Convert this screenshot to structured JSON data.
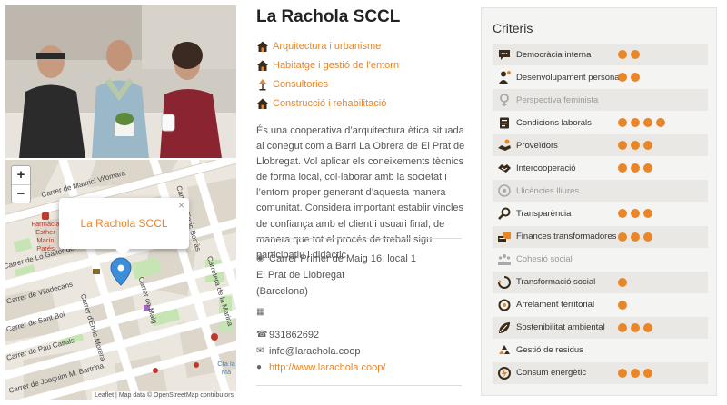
{
  "entity": {
    "name": "La Rachola SCCL",
    "activities": [
      {
        "label": "Arquitectura i urbanisme",
        "icon": "house-icon"
      },
      {
        "label": "Habitatge i gestió de l'entorn",
        "icon": "house-icon"
      },
      {
        "label": "Consultories",
        "icon": "lamp-icon"
      },
      {
        "label": "Construcció i rehabilitació",
        "icon": "house-icon"
      }
    ],
    "description": "És una cooperativa d’arquitectura ètica situada al conegut com a Barri La Obrera de El Prat de Llobregat. Vol aplicar els coneixements tècnics de forma local, col·laborar amb la societat i l’entorn proper generant d’aquesta manera comunitat. Considera important establir vincles de confiança amb el client i usuari final, de manera que tot el procés de treball sigui participatiu i didàctic.",
    "address": {
      "street": "Carrer Primer de Maig 16, local 1",
      "city": "El Prat de Llobregat",
      "region": "(Barcelona)"
    },
    "phone": "931862692",
    "email": "info@larachola.coop",
    "web": "http://www.larachola.coop/"
  },
  "map": {
    "popup_label": "La Rachola SCCL",
    "close_label": "×",
    "zoom_in": "+",
    "zoom_out": "−",
    "attribution": "Leaflet | Map data © OpenStreetMap contributors",
    "streets": [
      "Carrer de Maurici Vilomara",
      "Carrer de Lo Gaiter del Llobregat",
      "Carrer de Viladecans",
      "Carrer de Sant Boi",
      "Carrer de Pau Casals",
      "Carrer de Joaquim M. Bartrina",
      "Carrer d'Enric Morera",
      "Carrer d'Enric Borràs",
      "Carretera de la Marina",
      "Carrer de Maig"
    ],
    "poi": "Farmàcia Esther Marín Parés",
    "poi2": "Cta la Ma"
  },
  "criteria": {
    "title": "Criteris",
    "accent_color": "#e8862a",
    "items": [
      {
        "label": "Democràcia interna",
        "score": 2,
        "active": true,
        "icon": "speech-bubble-icon"
      },
      {
        "label": "Desenvolupament personal",
        "score": 2,
        "active": true,
        "icon": "person-icon"
      },
      {
        "label": "Perspectiva feminista",
        "score": 0,
        "active": false,
        "icon": "female-symbol-icon"
      },
      {
        "label": "Condicions laborals",
        "score": 4,
        "active": true,
        "icon": "clipboard-icon"
      },
      {
        "label": "Proveïdors",
        "score": 3,
        "active": true,
        "icon": "handshake-coins-icon"
      },
      {
        "label": "Intercooperació",
        "score": 3,
        "active": true,
        "icon": "handshake-icon"
      },
      {
        "label": "Llicències lliures",
        "score": 0,
        "active": false,
        "icon": "license-icon"
      },
      {
        "label": "Transparència",
        "score": 3,
        "active": true,
        "icon": "magnifier-icon"
      },
      {
        "label": "Finances transformadores",
        "score": 3,
        "active": true,
        "icon": "coins-icon"
      },
      {
        "label": "Cohesió social",
        "score": 0,
        "active": false,
        "icon": "community-icon"
      },
      {
        "label": "Transformació social",
        "score": 1,
        "active": true,
        "icon": "transform-icon"
      },
      {
        "label": "Arrelament territorial",
        "score": 1,
        "active": true,
        "icon": "location-target-icon"
      },
      {
        "label": "Sostenibilitat ambiental",
        "score": 3,
        "active": true,
        "icon": "leaf-icon"
      },
      {
        "label": "Gestió de residus",
        "score": 0,
        "active": true,
        "icon": "recycle-icon"
      },
      {
        "label": "Consum energètic",
        "score": 3,
        "active": true,
        "icon": "energy-icon"
      }
    ]
  }
}
